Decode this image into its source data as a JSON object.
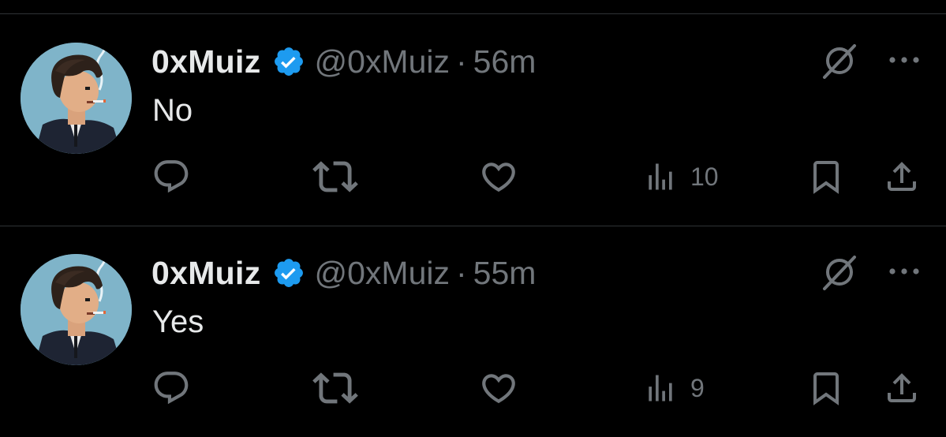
{
  "colors": {
    "background": "#000000",
    "primary_text": "#e7e9ea",
    "secondary_text": "#71767b",
    "divider": "#2f3336",
    "verified": "#1d9bf0",
    "avatar_bg": "#7fb4c9"
  },
  "posts": [
    {
      "author": {
        "display_name": "0xMuiz",
        "handle": "@0xMuiz",
        "verified": true,
        "avatar_icon": "pixel-art-avatar"
      },
      "separator": "·",
      "timestamp": "56m",
      "text": "No",
      "stats": {
        "views": "10"
      },
      "icons": [
        "grok-icon",
        "more-icon",
        "reply-icon",
        "repost-icon",
        "like-icon",
        "views-icon",
        "bookmark-icon",
        "share-icon"
      ]
    },
    {
      "author": {
        "display_name": "0xMuiz",
        "handle": "@0xMuiz",
        "verified": true,
        "avatar_icon": "pixel-art-avatar"
      },
      "separator": "·",
      "timestamp": "55m",
      "text": "Yes",
      "stats": {
        "views": "9"
      },
      "icons": [
        "grok-icon",
        "more-icon",
        "reply-icon",
        "repost-icon",
        "like-icon",
        "views-icon",
        "bookmark-icon",
        "share-icon"
      ]
    }
  ]
}
